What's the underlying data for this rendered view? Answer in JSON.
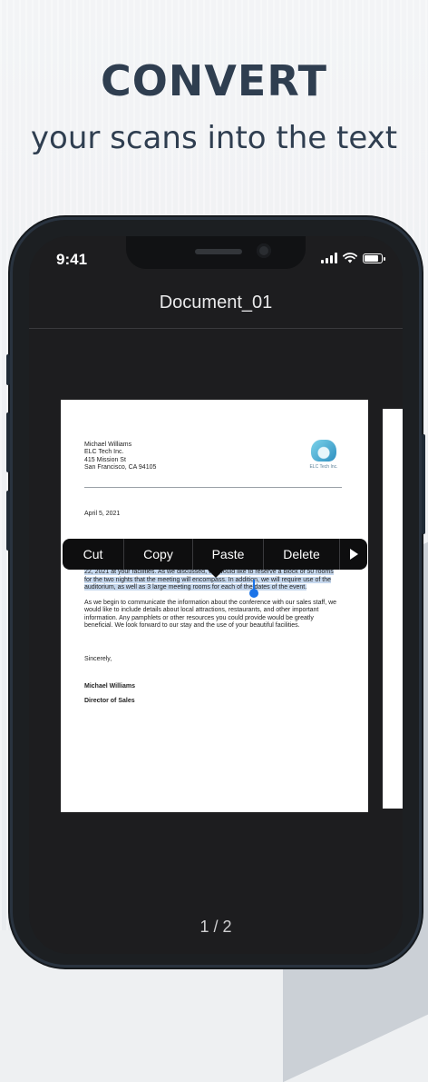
{
  "promo": {
    "headline": "CONVERT",
    "subheadline": "your scans into the text"
  },
  "status_bar": {
    "time": "9:41",
    "icons": [
      "signal-icon",
      "wifi-icon",
      "battery-icon"
    ]
  },
  "nav": {
    "title": "Document_01"
  },
  "document": {
    "address_lines": [
      "Michael Williams",
      "ELC Tech Inc.",
      "415 Mission St",
      "San Francisco, CA 94105"
    ],
    "logo_text": "ELC Tech Inc.",
    "date": "April 5, 2021",
    "paragraph1": "This letter will confirm our arrangements for our annual sales meeting to be held on July 20-22, 2021 at your facilities. As we discussed, we would like to reserve a block of 50 rooms for the two nights that the meeting will encompass. In addition, we will require use of the auditorium, as well as 3 large meeting rooms for each of the dates of the event.",
    "paragraph2": "As we begin to communicate the information about the conference with our sales staff, we would like to include details about local attractions, restaurants, and other important information. Any pamphlets or other resources you could provide would be greatly beneficial. We look forward to our stay and the use of your beautiful facilities.",
    "closing": "Sincerely,",
    "signature_name": "Michael Williams",
    "signature_title": "Director of Sales"
  },
  "context_menu": {
    "items": [
      "Cut",
      "Copy",
      "Paste",
      "Delete"
    ],
    "more_icon": "play-arrow-icon"
  },
  "pager": {
    "label": "1 / 2"
  },
  "colors": {
    "headline": "#2f3e50",
    "selection": "#c6d8ee",
    "handle": "#1a73e8",
    "screen_bg": "#1d1d1f"
  }
}
